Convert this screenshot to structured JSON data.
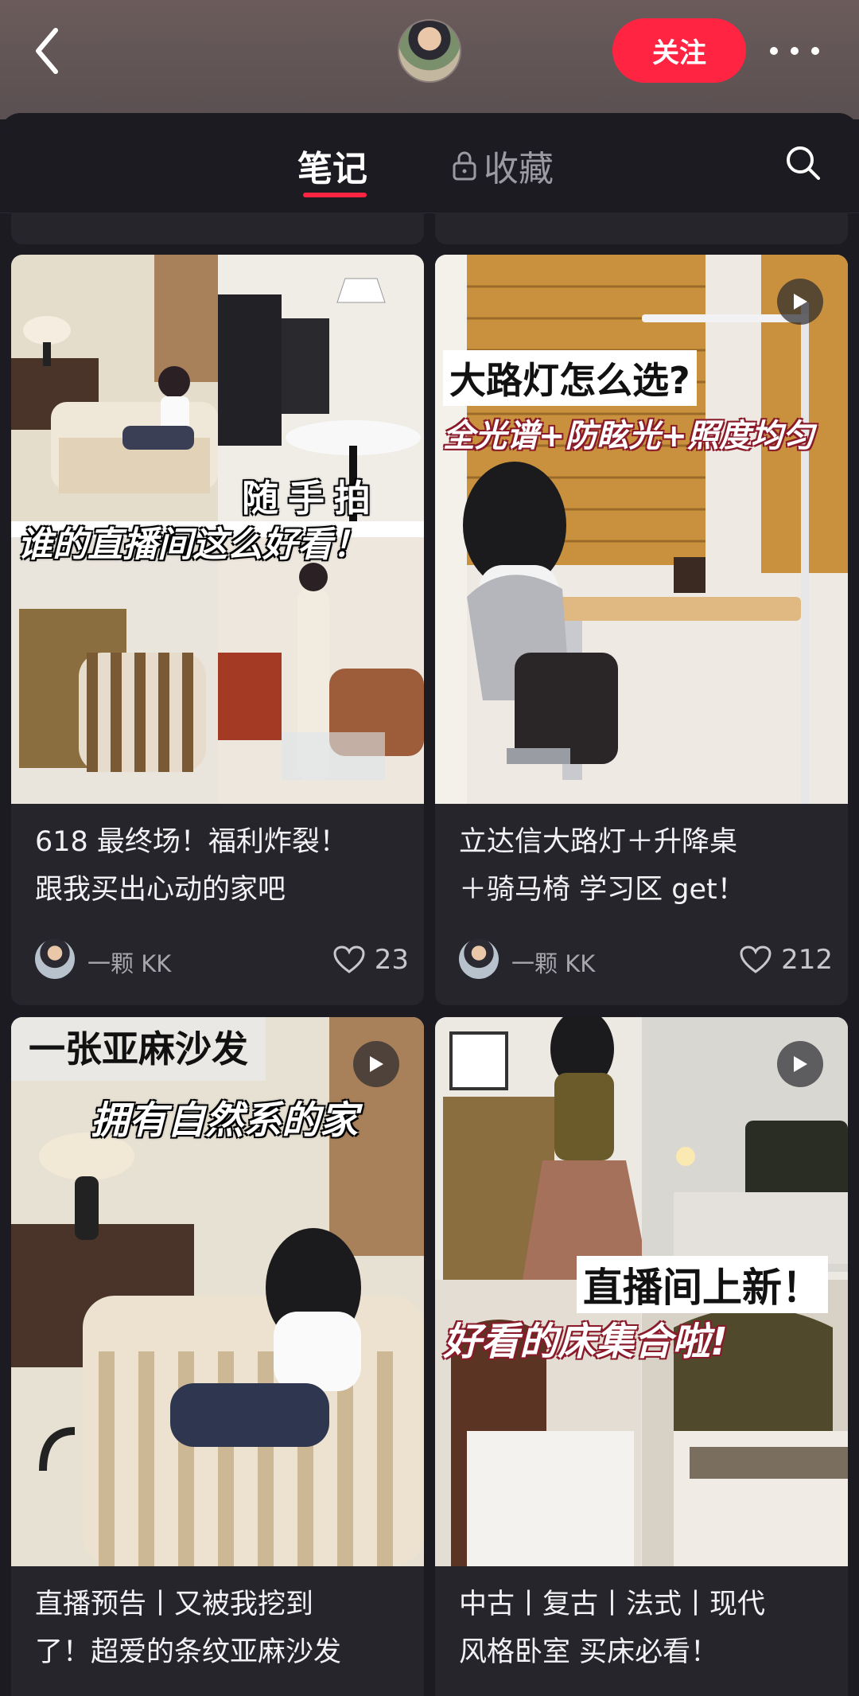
{
  "header": {
    "follow_label": "关注"
  },
  "tabs": {
    "notes_label": "笔记",
    "collect_label": "收藏"
  },
  "cards": [
    {
      "title_line1": "618 最终场！福利炸裂！",
      "title_line2": "跟我买出心动的家吧",
      "author": "一颗 KK",
      "likes": "23",
      "overlay_line1": "随手拍",
      "overlay_line2": "谁的直播间这么好看！",
      "is_video": false
    },
    {
      "title_line1": "立达信大路灯＋升降桌",
      "title_line2": "＋骑马椅 学习区 get！",
      "author": "一颗 KK",
      "likes": "212",
      "overlay_line1": "大路灯怎么选?",
      "overlay_line2": "全光谱+防眩光+照度均匀",
      "is_video": true
    },
    {
      "title_line1": "直播预告丨又被我挖到",
      "title_line2": "了！超爱的条纹亚麻沙发",
      "overlay_line1": "一张亚麻沙发",
      "overlay_line2": "拥有自然系的家",
      "is_video": true
    },
    {
      "title_line1": "中古丨复古丨法式丨现代",
      "title_line2": "风格卧室 买床必看！",
      "overlay_line1": "直播间上新！",
      "overlay_line2": "好看的床集合啦!",
      "is_video": true
    }
  ],
  "colors": {
    "accent": "#ff2442",
    "background": "#1c1b22",
    "card": "#26252c"
  },
  "icons": [
    "back-arrow-icon",
    "more-dots-icon",
    "lock-icon",
    "search-icon",
    "heart-icon",
    "play-icon"
  ]
}
